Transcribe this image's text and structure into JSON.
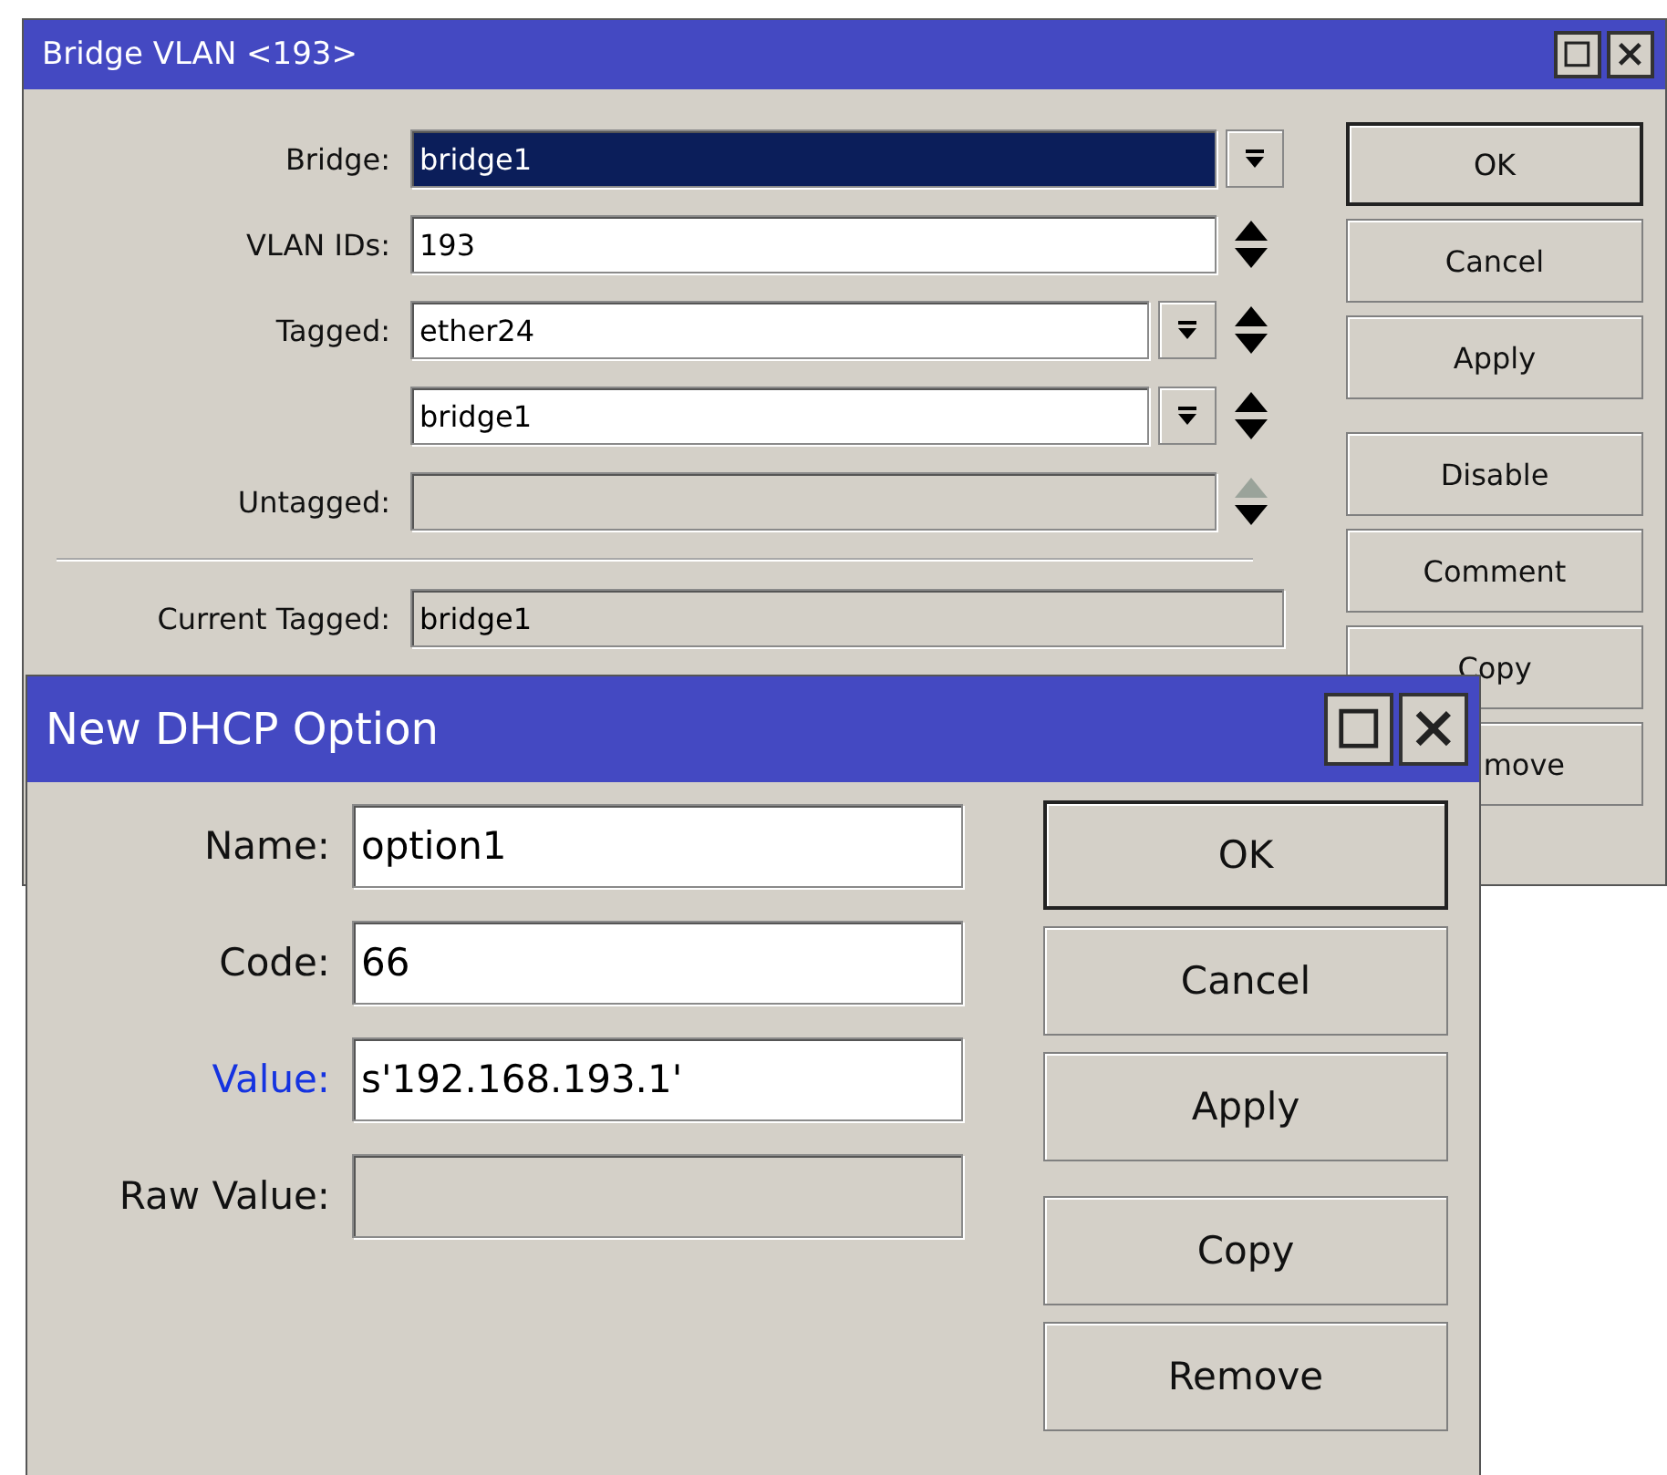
{
  "windows": [
    {
      "title": "Bridge VLAN <193>",
      "field_sections": [
        {
          "fields": [
            {
              "label": "Bridge:",
              "value": "bridge1",
              "highlighted": true,
              "dropdown": true,
              "spinner": false,
              "disabled": false,
              "emphasized": false
            },
            {
              "label": "VLAN IDs:",
              "value": "193",
              "highlighted": false,
              "dropdown": false,
              "spinner": true,
              "disabled": false,
              "emphasized": false
            },
            {
              "label": "Tagged:",
              "value": "ether24",
              "highlighted": false,
              "dropdown": true,
              "spinner": true,
              "disabled": false,
              "emphasized": false
            },
            {
              "value": "bridge1",
              "highlighted": false,
              "dropdown": true,
              "spinner": true,
              "disabled": false
            },
            {
              "label": "Untagged:",
              "highlighted": false,
              "dropdown": false,
              "spinner": true,
              "disabled": true,
              "emphasized": false
            }
          ]
        },
        {
          "fields": [
            {
              "label": "Current Tagged:",
              "value": "bridge1",
              "highlighted": false,
              "dropdown": false,
              "spinner": false,
              "disabled": true,
              "emphasized": false
            }
          ]
        }
      ],
      "button_groups": [
        {
          "buttons": [
            {
              "label": "OK",
              "default": true,
              "clipped": false
            },
            {
              "label": "Cancel",
              "default": false,
              "clipped": false
            },
            {
              "label": "Apply",
              "default": false,
              "clipped": false
            }
          ]
        },
        {
          "buttons": [
            {
              "label": "Disable",
              "default": false,
              "clipped": false
            },
            {
              "label": "Comment",
              "default": false,
              "clipped": false
            },
            {
              "label": "Copy",
              "default": false,
              "clipped": false
            },
            {
              "label": "move",
              "default": false,
              "clipped": true
            }
          ]
        }
      ]
    },
    {
      "title": "New DHCP Option",
      "field_sections": [
        {
          "fields": [
            {
              "label": "Name:",
              "value": "option1",
              "highlighted": false,
              "dropdown": false,
              "spinner": false,
              "disabled": false,
              "emphasized": false
            },
            {
              "label": "Code:",
              "value": "66",
              "highlighted": false,
              "dropdown": false,
              "spinner": false,
              "disabled": false,
              "emphasized": false
            },
            {
              "label": "Value:",
              "value": "s'192.168.193.1'",
              "highlighted": false,
              "dropdown": false,
              "spinner": false,
              "disabled": false,
              "emphasized": true
            },
            {
              "label": "Raw Value:",
              "highlighted": false,
              "dropdown": false,
              "spinner": false,
              "disabled": true,
              "emphasized": false
            }
          ]
        }
      ],
      "button_groups": [
        {
          "buttons": [
            {
              "label": "OK",
              "default": true,
              "clipped": false
            },
            {
              "label": "Cancel",
              "default": false,
              "clipped": false
            },
            {
              "label": "Apply",
              "default": false,
              "clipped": false
            }
          ]
        },
        {
          "buttons": [
            {
              "label": "Copy",
              "default": false,
              "clipped": false
            },
            {
              "label": "Remove",
              "default": false,
              "clipped": false
            }
          ]
        }
      ]
    }
  ]
}
